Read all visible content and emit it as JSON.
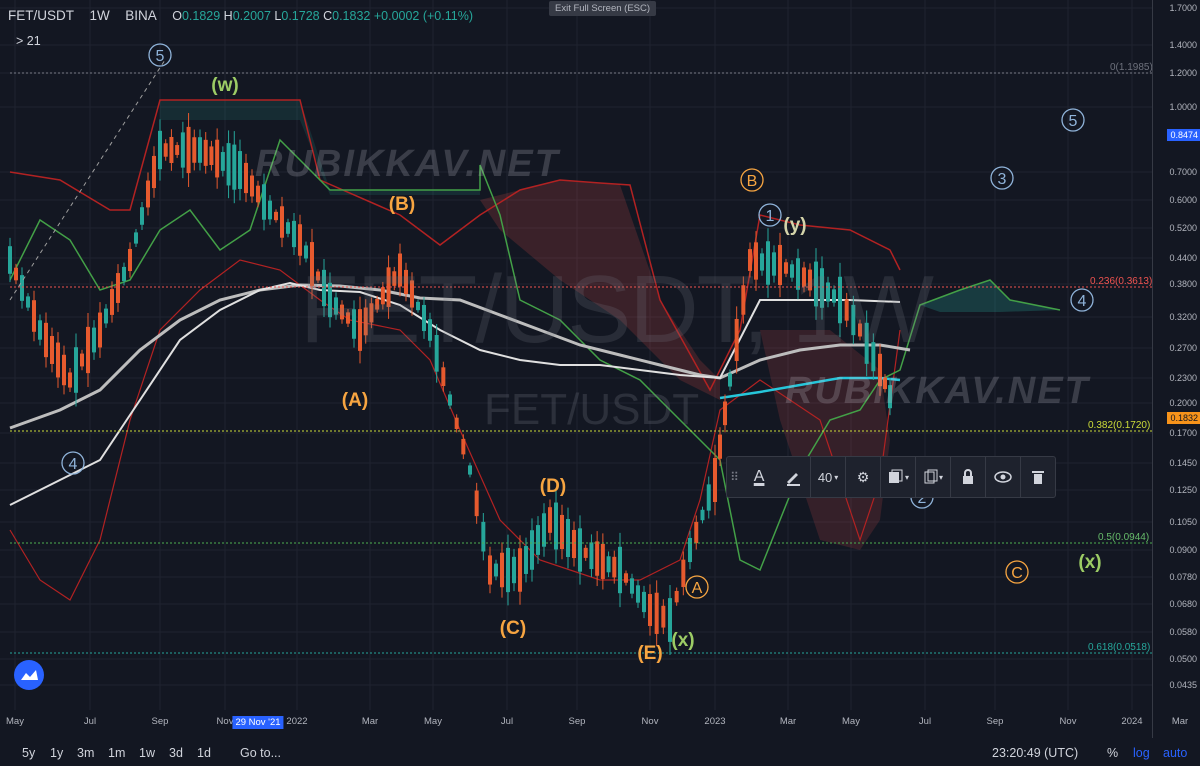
{
  "header": {
    "symbol": "FET/USDT",
    "interval": "1W",
    "exchange": "BINA",
    "o_label": "O",
    "o_value": "0.1829",
    "h_label": "H",
    "h_value": "0.2007",
    "l_label": "L",
    "l_value": "0.1728",
    "c_label": "C",
    "c_value": "0.1832",
    "change": "+0.0002 (+0.11%)",
    "indicators_toggle": "> 21"
  },
  "exit_fullscreen": "Exit Full Screen (ESC)",
  "watermarks": {
    "big": "FET/USDT, 1W",
    "small": "FET/USDT",
    "site_1": "RUBIKKAV.NET",
    "site_2": "RUBIKKAV.NET"
  },
  "price_axis": {
    "ticks": [
      "1.7000",
      "1.4000",
      "1.2000",
      "1.0000",
      "0.7000",
      "0.6000",
      "0.5200",
      "0.4400",
      "0.3800",
      "0.3200",
      "0.2700",
      "0.2300",
      "0.2000",
      "0.1700",
      "0.1450",
      "0.1250",
      "0.1050",
      "0.0900",
      "0.0780",
      "0.0680",
      "0.0580",
      "0.0500",
      "0.0435"
    ],
    "current_a": "0.8474",
    "current_b": "0.1832"
  },
  "fib": {
    "f0": "0(1.1985)",
    "f236": "0.236(0.3613)",
    "f382": "0.382(0.1720)",
    "f5": "0.5(0.0944)",
    "f618": "0.618(0.0518)"
  },
  "wave_labels": {
    "w5_top": "5",
    "w_w": "(w)",
    "wB_paren": "(B)",
    "wA_paren": "(A)",
    "w4_left": "4",
    "wD_paren": "(D)",
    "wC_paren": "(C)",
    "wE_paren": "(E)",
    "wx_low": "(x)",
    "wA_circ": "A",
    "wB_circ": "B",
    "w1": "1",
    "wy": "(y)",
    "w3": "3",
    "w5_right": "5",
    "w4_right": "4",
    "wC_circ": "C",
    "wx_right": "(x)",
    "w2": "2"
  },
  "time_axis": {
    "labels": [
      "May",
      "Jul",
      "Sep",
      "Nov",
      "2022",
      "Mar",
      "May",
      "Jul",
      "Sep",
      "Nov",
      "2023",
      "Mar",
      "May",
      "Jul",
      "Sep",
      "Nov",
      "2024",
      "Mar"
    ],
    "crosshair_date": "29 Nov '21"
  },
  "bottom_bar": {
    "ranges": [
      "5y",
      "1y",
      "3m",
      "1m",
      "1w",
      "3d",
      "1d"
    ],
    "goto": "Go to...",
    "clock": "23:20:49 (UTC)",
    "percent": "%",
    "log": "log",
    "auto": "auto"
  },
  "toolbar": {
    "drag_icon": "drag-handle-icon",
    "text_icon": "text-color-icon",
    "pencil_icon": "pencil-icon",
    "font_size": "40",
    "gear_icon": "gear-icon",
    "layers_icon": "layers-icon",
    "copy_icon": "copy-icon",
    "lock_icon": "lock-icon",
    "eye_icon": "eye-icon",
    "trash_icon": "trash-icon"
  },
  "colors": {
    "background": "#131722",
    "up": "#26a69a",
    "down": "#ef5350",
    "accent": "#2962ff",
    "wave_orange": "#f7a541",
    "wave_green": "#8bc34a",
    "wave_blue": "#8fb3d9"
  }
}
